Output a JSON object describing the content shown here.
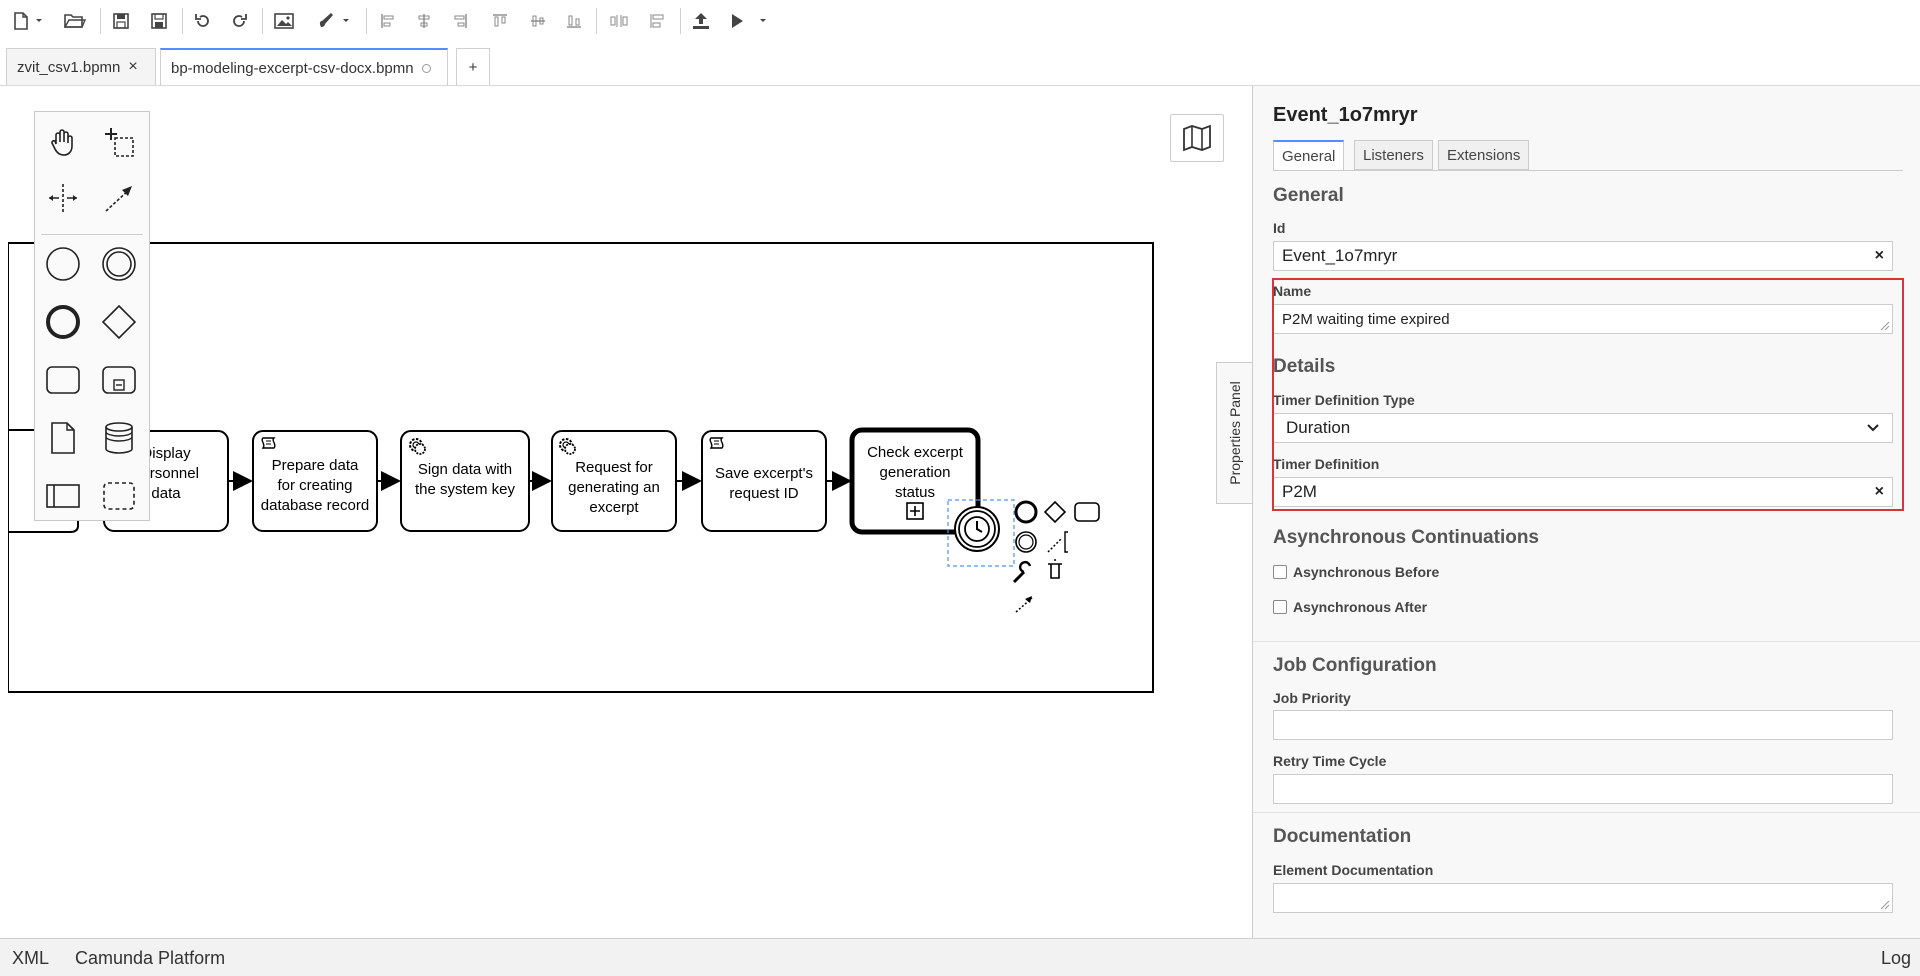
{
  "toolbar": {
    "buttons": [
      {
        "icon": "new-file-icon"
      },
      {
        "icon": "open-folder-icon"
      },
      {
        "icon": "save-icon"
      },
      {
        "icon": "save-as-icon"
      },
      {
        "icon": "undo-icon"
      },
      {
        "icon": "redo-icon"
      },
      {
        "icon": "image-export-icon"
      },
      {
        "icon": "paint-brush-icon"
      },
      {
        "icon": "align-left-icon"
      },
      {
        "icon": "align-center-icon"
      },
      {
        "icon": "align-right-icon"
      },
      {
        "icon": "align-top-icon"
      },
      {
        "icon": "align-middle-icon"
      },
      {
        "icon": "align-bottom-icon"
      },
      {
        "icon": "distribute-horizontal-icon"
      },
      {
        "icon": "distribute-vertical-icon"
      },
      {
        "icon": "deploy-icon"
      },
      {
        "icon": "run-icon"
      }
    ]
  },
  "tabs": [
    {
      "label": "zvit_csv1.bpmn",
      "active": false,
      "close": "×"
    },
    {
      "label": "bp-modeling-excerpt-csv-docx.bpmn",
      "active": true
    },
    {
      "label": "+"
    }
  ],
  "diagram": {
    "tasks": [
      {
        "lines": [
          "Display",
          "personnel",
          "data"
        ],
        "marker": "none"
      },
      {
        "lines": [
          "Prepare data",
          "for creating",
          "database record"
        ],
        "marker": "script"
      },
      {
        "lines": [
          "Sign data with",
          "the system key"
        ],
        "marker": "service"
      },
      {
        "lines": [
          "Request for",
          "generating an",
          "excerpt"
        ],
        "marker": "service"
      },
      {
        "lines": [
          "Save excerpt's",
          "request ID"
        ],
        "marker": "script"
      },
      {
        "lines": [
          "Check excerpt",
          "generation",
          "status"
        ],
        "marker": "subprocess"
      }
    ],
    "boundary_event": "timer-icon"
  },
  "palette": {
    "items": [
      "hand-tool-icon",
      "lasso-tool-icon",
      "space-tool-icon",
      "connect-tool-icon",
      "start-event-icon",
      "intermediate-event-icon",
      "end-event-icon",
      "gateway-icon",
      "task-icon",
      "subprocess-icon",
      "data-object-icon",
      "data-store-icon",
      "pool-icon",
      "group-icon"
    ]
  },
  "properties_toggle": "Properties Panel",
  "panel": {
    "title": "Event_1o7mryr",
    "tabs": [
      "General",
      "Listeners",
      "Extensions"
    ],
    "general": {
      "group_title": "General",
      "id_label": "Id",
      "id_value": "Event_1o7mryr",
      "name_label": "Name",
      "name_value": "P2M waiting time expired"
    },
    "details": {
      "group_title": "Details",
      "timer_type_label": "Timer Definition Type",
      "timer_type_value": "Duration",
      "timer_def_label": "Timer Definition",
      "timer_def_value": "P2M"
    },
    "async": {
      "group_title": "Asynchronous Continuations",
      "before": "Asynchronous Before",
      "after": "Asynchronous After"
    },
    "job": {
      "group_title": "Job Configuration",
      "priority_label": "Job Priority",
      "retry_label": "Retry Time Cycle"
    },
    "documentation": {
      "group_title": "Documentation",
      "element_label": "Element Documentation"
    },
    "clear": "×"
  },
  "statusbar": {
    "xml": "XML",
    "platform": "Camunda Platform",
    "log": "Log"
  },
  "colors": {
    "accent": "#4d90fe",
    "highlight": "#d9343a"
  }
}
